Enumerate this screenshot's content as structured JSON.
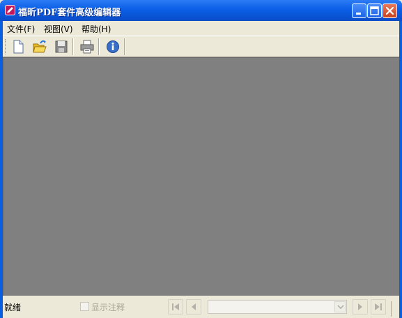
{
  "window": {
    "title": "福昕PDF套件高级编辑器",
    "icon": "pencil-app-icon",
    "controls": [
      "minimize-icon",
      "maximize-icon",
      "close-icon"
    ]
  },
  "menubar": {
    "items": [
      {
        "label": "文件(F)"
      },
      {
        "label": "视图(V)"
      },
      {
        "label": "帮助(H)"
      }
    ]
  },
  "toolbar": {
    "tools": [
      {
        "icon": "new-document-icon"
      },
      {
        "icon": "open-folder-icon"
      },
      {
        "icon": "save-disk-icon"
      },
      {
        "icon": "print-icon"
      },
      {
        "icon": "info-icon"
      }
    ]
  },
  "statusbar": {
    "status": "就绪",
    "show_annotations_label": "显示注释",
    "show_annotations_checked": false,
    "page_value": "",
    "nav_icons": [
      "first-page-icon",
      "prev-page-icon",
      "next-page-icon",
      "last-page-icon"
    ]
  },
  "colors": {
    "titlebar": "#0b5ee6",
    "workspace": "#808080",
    "chrome": "#ece9d8",
    "disabled_text": "#aca899"
  }
}
